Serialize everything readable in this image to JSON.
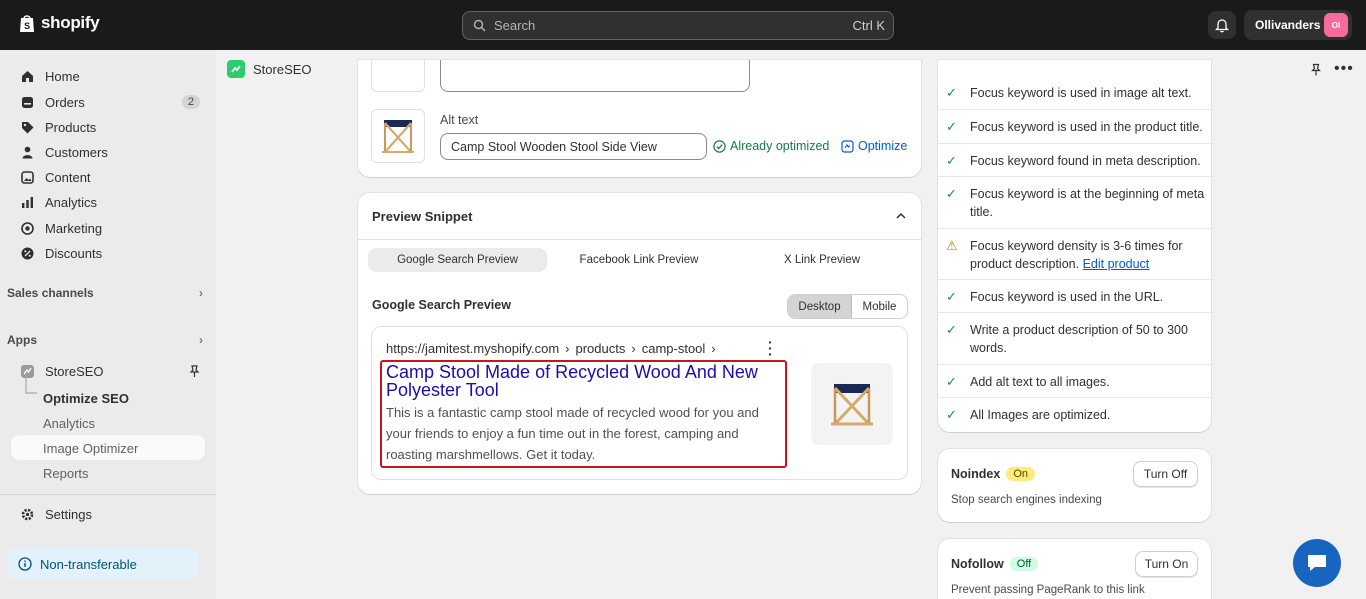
{
  "topbar": {
    "brand": "shopify",
    "search_placeholder": "Search",
    "search_shortcut": "Ctrl K",
    "store_name": "Ollivanders",
    "store_initials": "OI"
  },
  "sidebar": {
    "items": [
      {
        "label": "Home",
        "icon": "home-icon"
      },
      {
        "label": "Orders",
        "icon": "orders-icon",
        "badge": "2"
      },
      {
        "label": "Products",
        "icon": "tag-icon"
      },
      {
        "label": "Customers",
        "icon": "person-icon"
      },
      {
        "label": "Content",
        "icon": "content-icon"
      },
      {
        "label": "Analytics",
        "icon": "chart-icon"
      },
      {
        "label": "Marketing",
        "icon": "target-icon"
      },
      {
        "label": "Discounts",
        "icon": "discount-icon"
      }
    ],
    "sales_channels": "Sales channels",
    "apps": "Apps",
    "app_name": "StoreSEO",
    "sub_items": [
      "Optimize SEO",
      "Analytics",
      "Image Optimizer",
      "Reports"
    ],
    "settings": "Settings",
    "non_transferable": "Non-transferable"
  },
  "app_header": {
    "title": "StoreSEO"
  },
  "alt_text": {
    "label": "Alt text",
    "value": "Camp Stool Wooden Stool Side View",
    "status": "Already optimized",
    "optimize": "Optimize"
  },
  "preview": {
    "title": "Preview Snippet",
    "tabs": [
      "Google Search Preview",
      "Facebook Link Preview",
      "X Link Preview"
    ],
    "section_title": "Google Search Preview",
    "devices": [
      "Desktop",
      "Mobile"
    ],
    "url_parts": [
      "https://jamitest.myshopify.com",
      "products",
      "camp-stool"
    ],
    "result_title": "Camp Stool Made of Recycled Wood And New Polyester Tool",
    "result_description": "This is a fantastic camp stool made of recycled wood for you and your friends to enjoy a fun time out in the forest, camping and roasting marshmellows. Get it today."
  },
  "checklist": [
    {
      "text": "Focus keyword is used in image alt text.",
      "status": "ok"
    },
    {
      "text": "Focus keyword is used in the product title.",
      "status": "ok"
    },
    {
      "text": "Focus keyword found in meta description.",
      "status": "ok"
    },
    {
      "text": "Focus keyword is at the beginning of meta title.",
      "status": "ok"
    },
    {
      "text": "Focus keyword density is 3-6 times for product description.",
      "status": "warning",
      "link": "Edit product"
    },
    {
      "text": "Focus keyword is used in the URL.",
      "status": "ok"
    },
    {
      "text": "Write a product description of 50 to 300 words.",
      "status": "ok"
    },
    {
      "text": "Add alt text to all images.",
      "status": "ok"
    },
    {
      "text": "All Images are optimized.",
      "status": "ok"
    }
  ],
  "noindex": {
    "title": "Noindex",
    "badge": "On",
    "button": "Turn Off",
    "description": "Stop search engines indexing"
  },
  "nofollow": {
    "title": "Nofollow",
    "badge": "Off",
    "button": "Turn On",
    "description": "Prevent passing PageRank to this link"
  },
  "colors": {
    "accent": "#005bd3",
    "highlight_border": "#c4161c",
    "link_title": "#1a0dab",
    "success": "#1a8a4f"
  }
}
